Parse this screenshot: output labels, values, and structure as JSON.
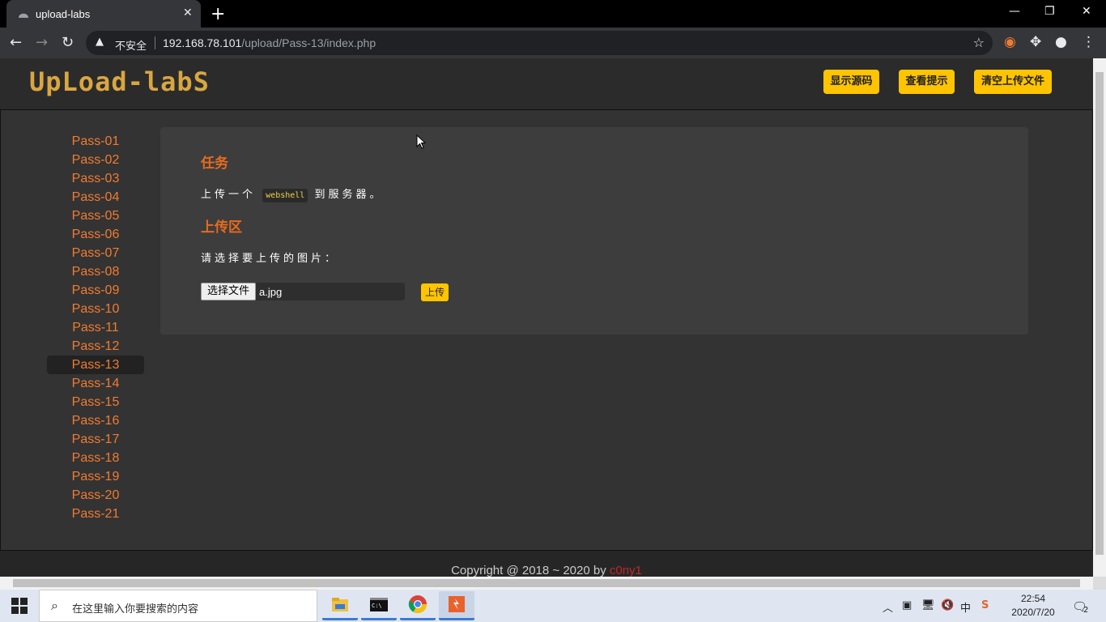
{
  "browser": {
    "tab_title": "upload-labs",
    "insecure_label": "不安全",
    "url_host": "192.168.78.101",
    "url_path": "/upload/Pass-13/index.php"
  },
  "header": {
    "logo_text": "UpLoad-labS",
    "buttons": [
      "显示源码",
      "查看提示",
      "清空上传文件"
    ]
  },
  "sidebar": {
    "items": [
      "Pass-01",
      "Pass-02",
      "Pass-03",
      "Pass-04",
      "Pass-05",
      "Pass-06",
      "Pass-07",
      "Pass-08",
      "Pass-09",
      "Pass-10",
      "Pass-11",
      "Pass-12",
      "Pass-13",
      "Pass-14",
      "Pass-15",
      "Pass-16",
      "Pass-17",
      "Pass-18",
      "Pass-19",
      "Pass-20",
      "Pass-21"
    ],
    "active": "Pass-13"
  },
  "task": {
    "heading": "任务",
    "text_before": "上传一个",
    "code": "webshell",
    "text_after": "到服务器。"
  },
  "upload": {
    "heading": "上传区",
    "prompt": "请选择要上传的图片：",
    "choose_button": "选择文件",
    "file_name": "a.jpg",
    "submit_button": "上传"
  },
  "footer": {
    "copyright": "Copyright @ 2018 ~ 2020 by ",
    "author": "c0ny1"
  },
  "taskbar": {
    "search_placeholder": "在这里输入你要搜索的内容",
    "ime": "中",
    "time": "22:54",
    "date": "2020/7/20",
    "notification_count": "2"
  },
  "colors": {
    "accent_yellow": "#ffc400",
    "link_orange": "#f07b32",
    "heading_orange": "#e76a1f",
    "page_bg": "#333333"
  }
}
